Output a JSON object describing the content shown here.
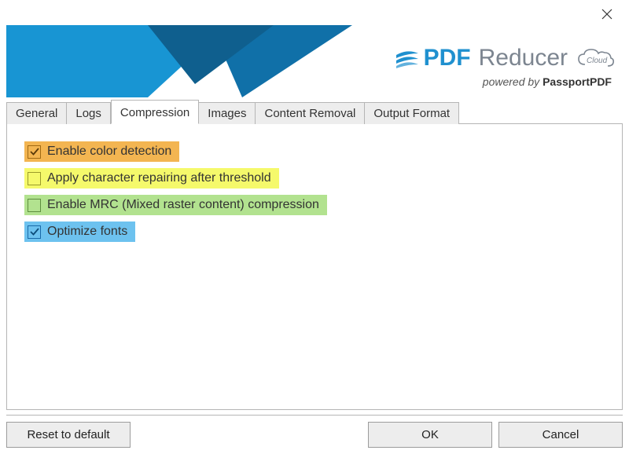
{
  "close_icon": "close",
  "logo": {
    "brand_strong": "PDF",
    "brand_thin": "Reducer",
    "cloud_label": "Cloud"
  },
  "powered_by_prefix": "powered by ",
  "powered_by_brand": "PassportPDF",
  "tabs": {
    "general": "General",
    "logs": "Logs",
    "compression": "Compression",
    "images": "Images",
    "content_removal": "Content Removal",
    "output_format": "Output Format"
  },
  "active_tab": "compression",
  "options": {
    "color_detection": {
      "label": "Enable color detection",
      "checked": true
    },
    "char_repair": {
      "label": "Apply character repairing after threshold",
      "checked": false
    },
    "mrc": {
      "label": "Enable MRC (Mixed raster content) compression",
      "checked": false
    },
    "optimize_fonts": {
      "label": "Optimize fonts",
      "checked": true
    }
  },
  "buttons": {
    "reset": "Reset to default",
    "ok": "OK",
    "cancel": "Cancel"
  },
  "colors": {
    "brand_blue": "#1f90cf",
    "highlight_orange": "#f3b551",
    "highlight_yellow": "#f5f96b",
    "highlight_green": "#b2e28f",
    "highlight_blue": "#6dc2ef"
  }
}
